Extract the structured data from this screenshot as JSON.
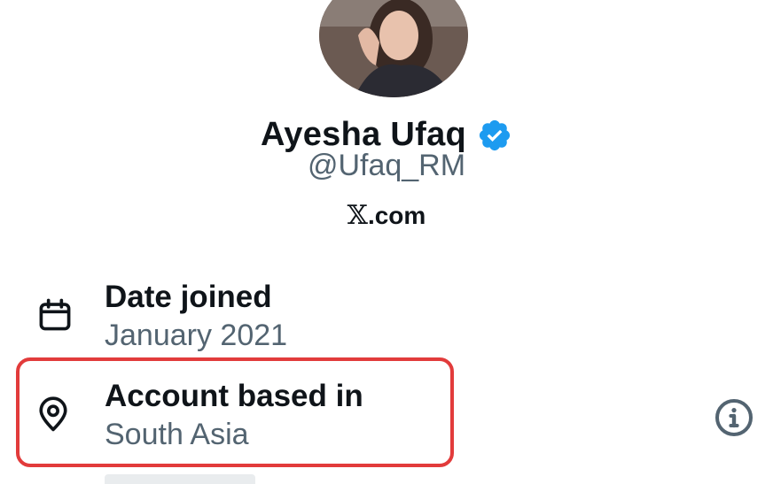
{
  "profile": {
    "display_name": "Ayesha Ufaq",
    "handle": "@Ufaq_RM",
    "site_x": "𝕏",
    "site_suffix": ".com",
    "verified": true
  },
  "about": {
    "date_joined": {
      "label": "Date joined",
      "value": "January 2021",
      "icon": "calendar-icon"
    },
    "account_based_in": {
      "label": "Account based in",
      "value": "South Asia",
      "icon": "location-pin-icon",
      "info_icon": "info-icon"
    }
  },
  "colors": {
    "primary_text": "#0f1419",
    "secondary_text": "#536471",
    "verified_blue": "#1d9bf0",
    "highlight_red": "#e23b3b"
  }
}
